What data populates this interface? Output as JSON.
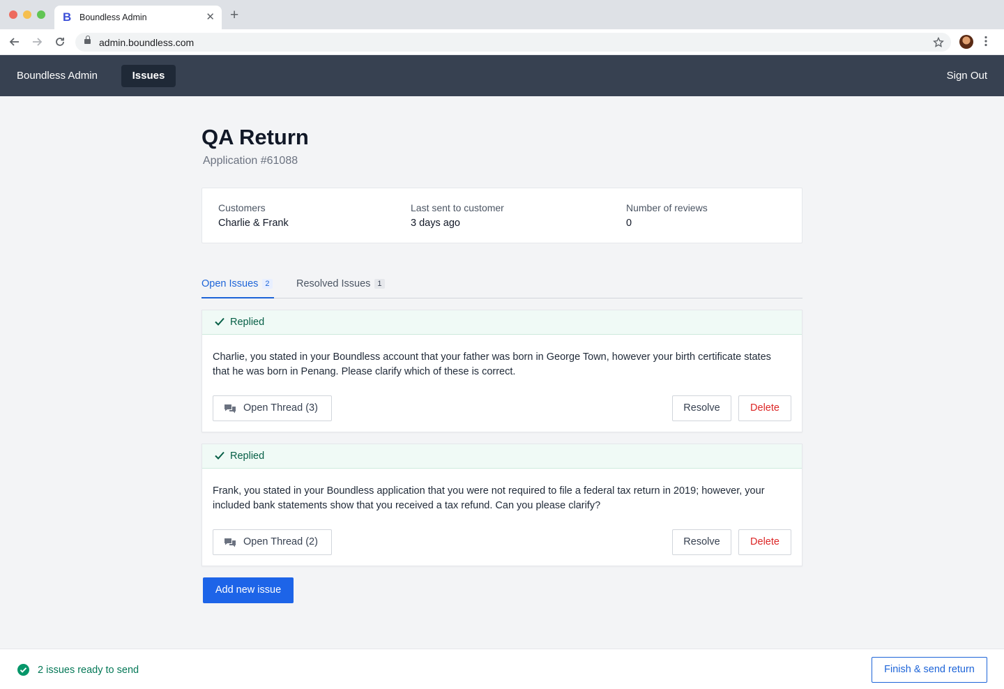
{
  "browser": {
    "tab_title": "Boundless Admin",
    "favicon_letter": "B",
    "url": "admin.boundless.com",
    "tab_close": "✕",
    "new_tab": "+"
  },
  "nav": {
    "brand": "Boundless Admin",
    "active_item": "Issues",
    "sign_out": "Sign Out"
  },
  "page": {
    "title": "QA Return",
    "subtitle": "Application #61088"
  },
  "summary": {
    "customers_label": "Customers",
    "customers_value": "Charlie & Frank",
    "last_sent_label": "Last sent to customer",
    "last_sent_value": "3 days ago",
    "reviews_label": "Number of reviews",
    "reviews_value": "0"
  },
  "tabs": {
    "open_label": "Open Issues",
    "open_count": "2",
    "resolved_label": "Resolved Issues",
    "resolved_count": "1"
  },
  "issues": [
    {
      "status": "Replied",
      "text": "Charlie, you stated in your Boundless account that your father was born in George Town, however your birth certificate states that he was born in Penang. Please clarify which of these is correct.",
      "thread_label": "Open Thread (3)",
      "resolve_label": "Resolve",
      "delete_label": "Delete"
    },
    {
      "status": "Replied",
      "text": "Frank, you stated in your Boundless application that you were not required to file a federal tax return in 2019; however, your included bank statements show that you received a tax refund. Can you please clarify?",
      "thread_label": "Open Thread (2)",
      "resolve_label": "Resolve",
      "delete_label": "Delete"
    }
  ],
  "add_issue_label": "Add new issue",
  "footer": {
    "ready_text": "2 issues ready to send",
    "finish_label": "Finish & send return"
  },
  "colors": {
    "nav_bg": "#374151",
    "primary": "#1d64e8",
    "success": "#047857",
    "danger": "#dc2626"
  },
  "icons": [
    "lock-icon",
    "star-icon",
    "check-icon",
    "chat-icon",
    "check-circle-icon"
  ]
}
